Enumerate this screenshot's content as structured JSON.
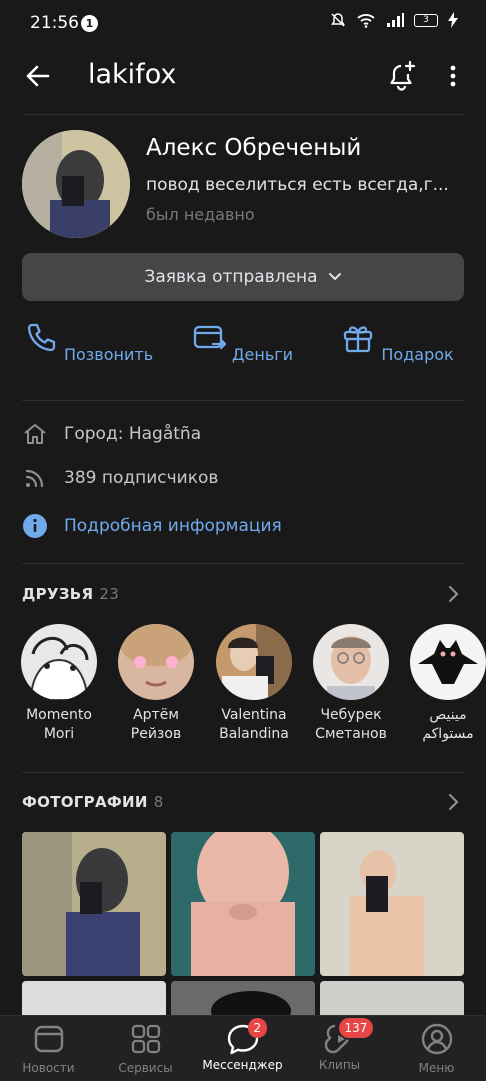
{
  "statusbar": {
    "time": "21:56",
    "notif_count": "1",
    "battery": "3"
  },
  "header": {
    "username": "lakifox"
  },
  "profile": {
    "name": "Алекс Обреченый",
    "status": "повод веселиться есть всегда,г...",
    "last_seen": "был недавно",
    "request_button": "Заявка отправлена"
  },
  "actions": [
    {
      "label": "Позвонить",
      "icon": "phone-icon"
    },
    {
      "label": "Деньги",
      "icon": "money-transfer-icon"
    },
    {
      "label": "Подарок",
      "icon": "gift-icon"
    }
  ],
  "info": {
    "city": "Город: Hagåtña",
    "followers": "389 подписчиков",
    "details_link": "Подробная информация"
  },
  "friends": {
    "title": "ДРУЗЬЯ",
    "count": "23",
    "items": [
      {
        "name1": "Momento",
        "name2": "Mori"
      },
      {
        "name1": "Артём",
        "name2": "Рейзов"
      },
      {
        "name1": "Valentina",
        "name2": "Balandina"
      },
      {
        "name1": "Чебурек",
        "name2": "Сметанов"
      },
      {
        "name1": "مينيص",
        "name2": "مستواكم"
      }
    ]
  },
  "photos": {
    "title": "ФОТОГРАФИИ",
    "count": "8"
  },
  "tabbar": {
    "items": [
      {
        "label": "Новости",
        "icon": "news-icon"
      },
      {
        "label": "Сервисы",
        "icon": "services-icon"
      },
      {
        "label": "Мессенджер",
        "icon": "messenger-icon",
        "badge": "2"
      },
      {
        "label": "Клипы",
        "icon": "clips-icon",
        "badge": "137"
      },
      {
        "label": "Меню",
        "icon": "menu-profile-icon"
      }
    ]
  }
}
